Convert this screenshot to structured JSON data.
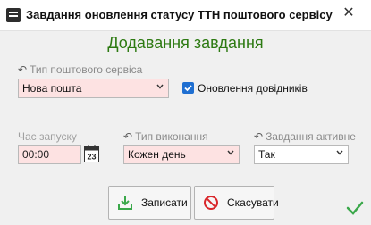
{
  "window": {
    "title": "Завдання оновлення статусу ТТН поштового сервісу",
    "close_symbol": "✕"
  },
  "heading": "Додавання завдання",
  "fields": {
    "postal_service_type": {
      "label": "Тип поштового сервіса",
      "value": "Нова пошта"
    },
    "update_directories": {
      "label": "Оновлення довідників",
      "checked": true
    },
    "start_time": {
      "label": "Час запуску",
      "value": "00:00",
      "calendar_day": "23"
    },
    "execution_type": {
      "label": "Тип виконання",
      "value": "Кожен день"
    },
    "task_active": {
      "label": "Завдання активне",
      "value": "Так"
    }
  },
  "buttons": {
    "save_label": "Записати",
    "cancel_label": "Скасувати"
  },
  "colors": {
    "heading": "#2d7a12",
    "required_field_bg": "#fde2e2",
    "checkbox": "#1f6fd1",
    "ok_check": "#3aa84a"
  },
  "icons": {
    "app": "list-icon",
    "undo": "undo-arrow-icon",
    "calendar": "calendar-icon",
    "save": "save-download-icon",
    "cancel": "no-entry-icon",
    "ok": "checkmark-icon"
  }
}
